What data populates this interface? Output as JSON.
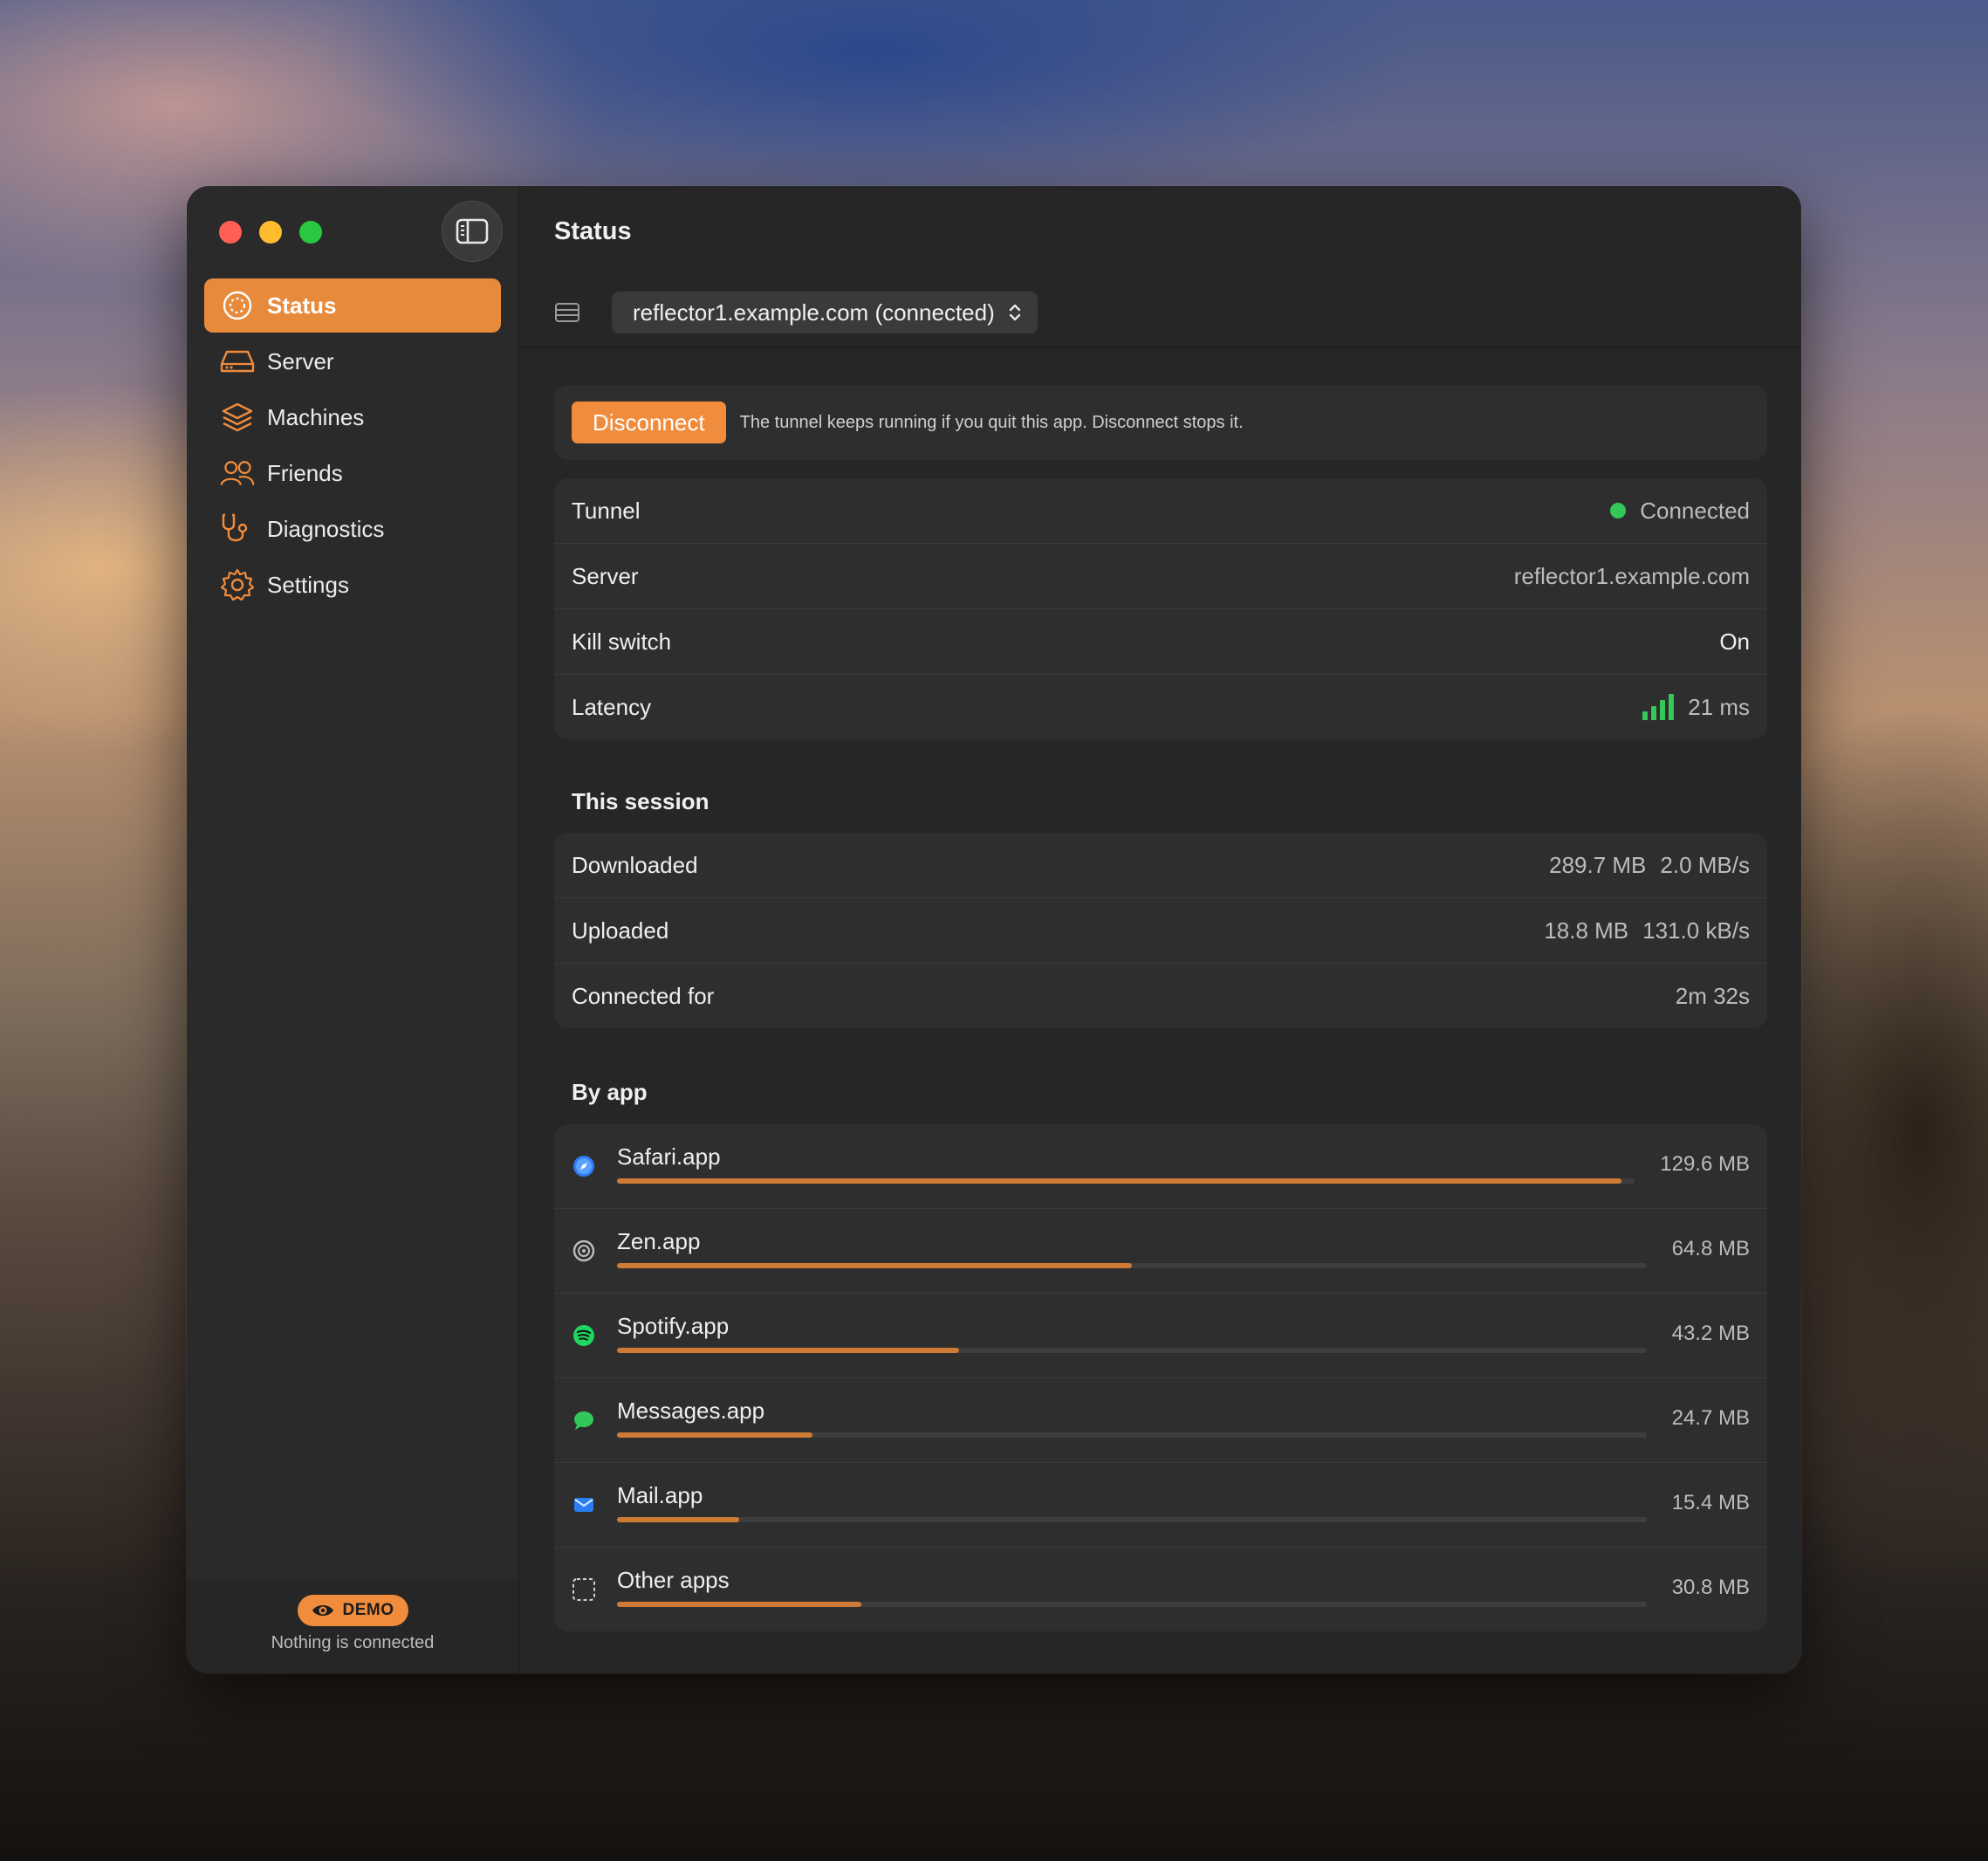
{
  "sidebar": {
    "items": [
      {
        "label": "Status",
        "icon": "status-icon"
      },
      {
        "label": "Server",
        "icon": "server-icon"
      },
      {
        "label": "Machines",
        "icon": "layers-icon"
      },
      {
        "label": "Friends",
        "icon": "people-icon"
      },
      {
        "label": "Diagnostics",
        "icon": "stethoscope-icon"
      },
      {
        "label": "Settings",
        "icon": "gear-icon"
      }
    ],
    "demo_badge": "DEMO",
    "footer_note": "Nothing is connected"
  },
  "header": {
    "title": "Status",
    "server_select": "reflector1.example.com (connected)"
  },
  "banner": {
    "button": "Disconnect",
    "note": "The tunnel keeps running if you quit this app. Disconnect stops it."
  },
  "status": {
    "tunnel_label": "Tunnel",
    "tunnel_value": "Connected",
    "server_label": "Server",
    "server_value": "reflector1.example.com",
    "kill_label": "Kill switch",
    "kill_value": "On",
    "latency_label": "Latency",
    "latency_value": "21 ms"
  },
  "session": {
    "title": "This session",
    "downloaded_label": "Downloaded",
    "downloaded_total": "289.7 MB",
    "downloaded_rate": "2.0 MB/s",
    "uploaded_label": "Uploaded",
    "uploaded_total": "18.8 MB",
    "uploaded_rate": "131.0 kB/s",
    "connected_label": "Connected for",
    "connected_value": "2m 32s"
  },
  "by_app": {
    "title": "By app",
    "apps": [
      {
        "name": "Safari.app",
        "size": "129.6 MB",
        "share": 0.9868
      },
      {
        "name": "Zen.app",
        "size": "64.8 MB",
        "share": 0.4996
      },
      {
        "name": "Spotify.app",
        "size": "43.2 MB",
        "share": 0.3325
      },
      {
        "name": "Messages.app",
        "size": "24.7 MB",
        "share": 0.1901
      },
      {
        "name": "Mail.app",
        "size": "15.4 MB",
        "share": 0.1187
      },
      {
        "name": "Other apps",
        "size": "30.8 MB",
        "share": 0.2373
      }
    ]
  },
  "colors": {
    "accent": "#f08c3c",
    "connected": "#35c759"
  }
}
